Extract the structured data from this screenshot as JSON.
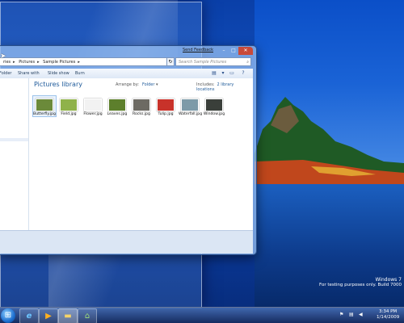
{
  "window": {
    "breadcrumb": [
      "ries",
      "Pictures",
      "Sample Pictures"
    ],
    "search_placeholder": "Search Sample Pictures",
    "feedback_link": "Send Feedback",
    "toolbar": [
      "Folder",
      "Share with",
      "Slide show",
      "Burn"
    ],
    "library_title": "Pictures library",
    "arrange_label": "Arrange by:",
    "arrange_value": "Folder",
    "includes_label": "Includes:",
    "includes_value": "2 library locations",
    "files": [
      {
        "name": "Butterfly.jpg",
        "color": "#6b8a3a",
        "selected": true
      },
      {
        "name": "Field.jpg",
        "color": "#8fb24a",
        "selected": false
      },
      {
        "name": "Flower.jpg",
        "color": "#f2f2f2",
        "selected": false
      },
      {
        "name": "Leaves.jpg",
        "color": "#5d7f2c",
        "selected": false
      },
      {
        "name": "Rocks.jpg",
        "color": "#6d6a63",
        "selected": false
      },
      {
        "name": "Tulip.jpg",
        "color": "#c8322a",
        "selected": false
      },
      {
        "name": "Waterfall.jpg",
        "color": "#7d9aa8",
        "selected": false
      },
      {
        "name": "Window.jpg",
        "color": "#3a3f3a",
        "selected": false
      }
    ]
  },
  "taskbar": {
    "buttons": [
      {
        "name": "start-button",
        "icon": "windows-orb"
      },
      {
        "name": "ie-button",
        "icon": "internet-explorer-icon"
      },
      {
        "name": "media-player-button",
        "icon": "media-player-icon"
      },
      {
        "name": "explorer-button",
        "icon": "folder-icon"
      },
      {
        "name": "network-button",
        "icon": "network-icon"
      }
    ],
    "time": "3:34 PM",
    "date": "1/14/2009"
  },
  "watermark": {
    "line1": "Windows 7",
    "line2": "For testing purposes only. Build 7000"
  }
}
